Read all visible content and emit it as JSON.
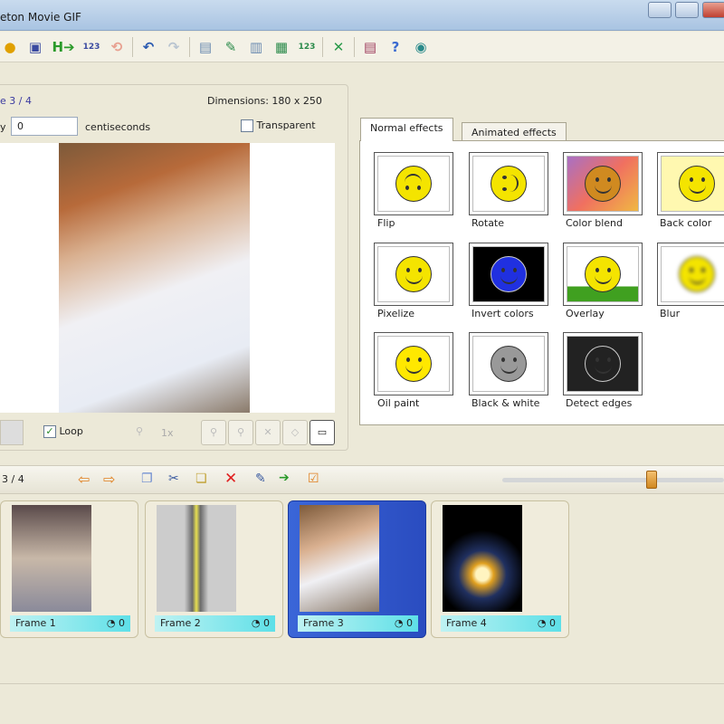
{
  "window": {
    "title": "eton Movie GIF"
  },
  "toolbar": {
    "icons": [
      "open-icon",
      "save-icon",
      "export-icon",
      "numbering-icon",
      "loop-icon",
      "undo-icon",
      "redo-icon",
      "add-frame-icon",
      "edit-frame-icon",
      "insert-frame-icon",
      "replace-frame-icon",
      "renumber-icon",
      "resize-icon",
      "settings-icon",
      "help-icon",
      "web-icon"
    ]
  },
  "frame_panel": {
    "frame_label": "e 3 / 4",
    "dimensions": "Dimensions: 180 x 250",
    "delay_label": "y",
    "delay_value": "0",
    "delay_unit": "centiseconds",
    "transparent_label": "Transparent",
    "loop_label": "Loop",
    "zoom_label": "1x"
  },
  "effects": {
    "tabs": [
      "Normal effects",
      "Animated effects"
    ],
    "items": [
      "Flip",
      "Rotate",
      "Color blend",
      "Back color",
      "Pixelize",
      "Invert colors",
      "Overlay",
      "Blur",
      "Oil paint",
      "Black & white",
      "Detect edges"
    ]
  },
  "frames_toolbar": {
    "counter": "3 / 4"
  },
  "frames": [
    {
      "label": "Frame 1",
      "delay": "0"
    },
    {
      "label": "Frame 2",
      "delay": "0"
    },
    {
      "label": "Frame 3",
      "delay": "0",
      "selected": true
    },
    {
      "label": "Frame 4",
      "delay": "0"
    }
  ],
  "colors": {
    "selected": "#2a4cc0",
    "accent": "#e08020"
  }
}
